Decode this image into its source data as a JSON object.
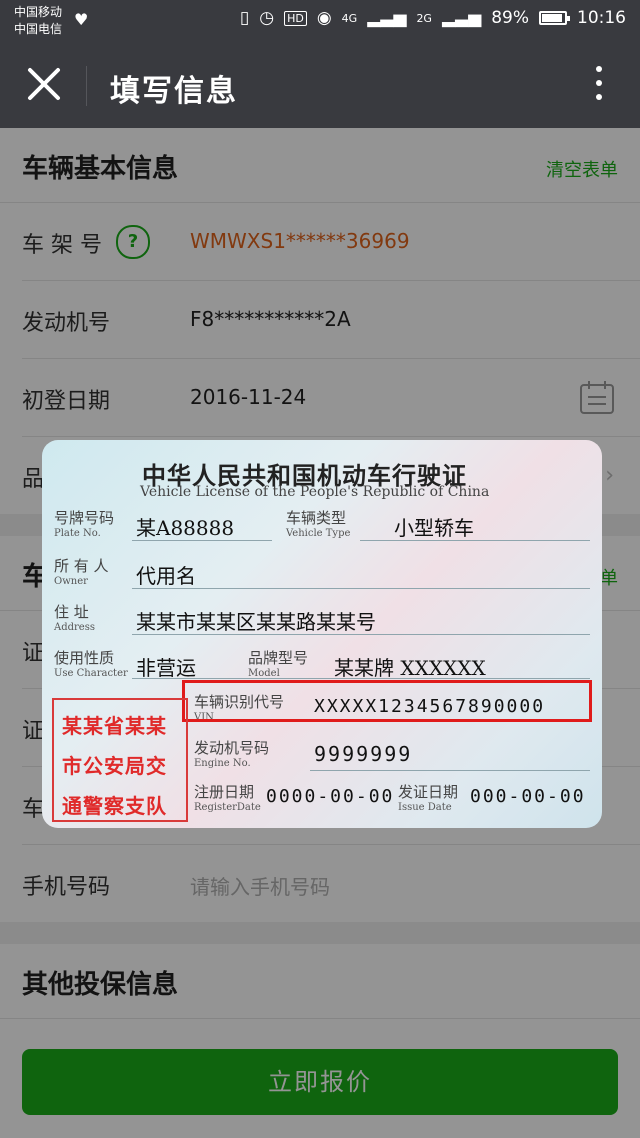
{
  "status_bar": {
    "carrier_1": "中国移动",
    "carrier_2": "中国电信",
    "net_1": "4G",
    "net_2": "2G",
    "hd": "HD",
    "battery": "89%",
    "time": "10:16"
  },
  "title_bar": {
    "title": "填写信息"
  },
  "vehicle_section": {
    "title": "车辆基本信息",
    "clear_label": "清空表单",
    "rows": [
      {
        "label": "车 架 号",
        "value": "WMWXS1******36969"
      },
      {
        "label": "发动机号",
        "value": "F8***********2A"
      },
      {
        "label": "初登日期",
        "value": "2016-11-24"
      },
      {
        "label": "品",
        "value": ""
      }
    ]
  },
  "owner_section": {
    "title": "车",
    "clear_label": "单",
    "rows": [
      {
        "label": "证"
      },
      {
        "label": "证"
      },
      {
        "label": "车"
      },
      {
        "label": "手机号码",
        "placeholder": "请输入手机号码"
      }
    ]
  },
  "other_section": {
    "title": "其他投保信息"
  },
  "submit": {
    "label": "立即报价"
  },
  "license": {
    "title": "中华人民共和国机动车行驶证",
    "subtitle": "Vehicle License of the People's Republic of China",
    "plate_label": "号牌号码",
    "plate_label_en": "Plate No.",
    "plate_value": "某A88888",
    "type_label": "车辆类型",
    "type_label_en": "Vehicle Type",
    "type_value": "小型轿车",
    "owner_label": "所 有 人",
    "owner_label_en": "Owner",
    "owner_value": "代用名",
    "address_label": "住    址",
    "address_label_en": "Address",
    "address_value": "某某市某某区某某路某某号",
    "use_label": "使用性质",
    "use_label_en": "Use Character",
    "use_value": "非营运",
    "model_label": "品牌型号",
    "model_label_en": "Model",
    "model_value": "某某牌 XXXXXX",
    "vin_label": "车辆识别代号",
    "vin_label_en": "VIN",
    "vin_value": "XXXXX1234567890000",
    "engine_label": "发动机号码",
    "engine_label_en": "Engine No.",
    "engine_value": "9999999",
    "register_label": "注册日期",
    "register_label_en": "RegisterDate",
    "register_value": "0000-00-00",
    "issue_label": "发证日期",
    "issue_label_en": "Issue Date",
    "issue_value": "000-00-00",
    "stamp_lines": [
      "某某省某某",
      "市公安局交",
      "通警察支队"
    ]
  },
  "colors": {
    "accent": "#1aad19",
    "title_bar": "#393a3f",
    "vin_highlight": "#e01b1b",
    "orange_value": "#e0631b"
  }
}
